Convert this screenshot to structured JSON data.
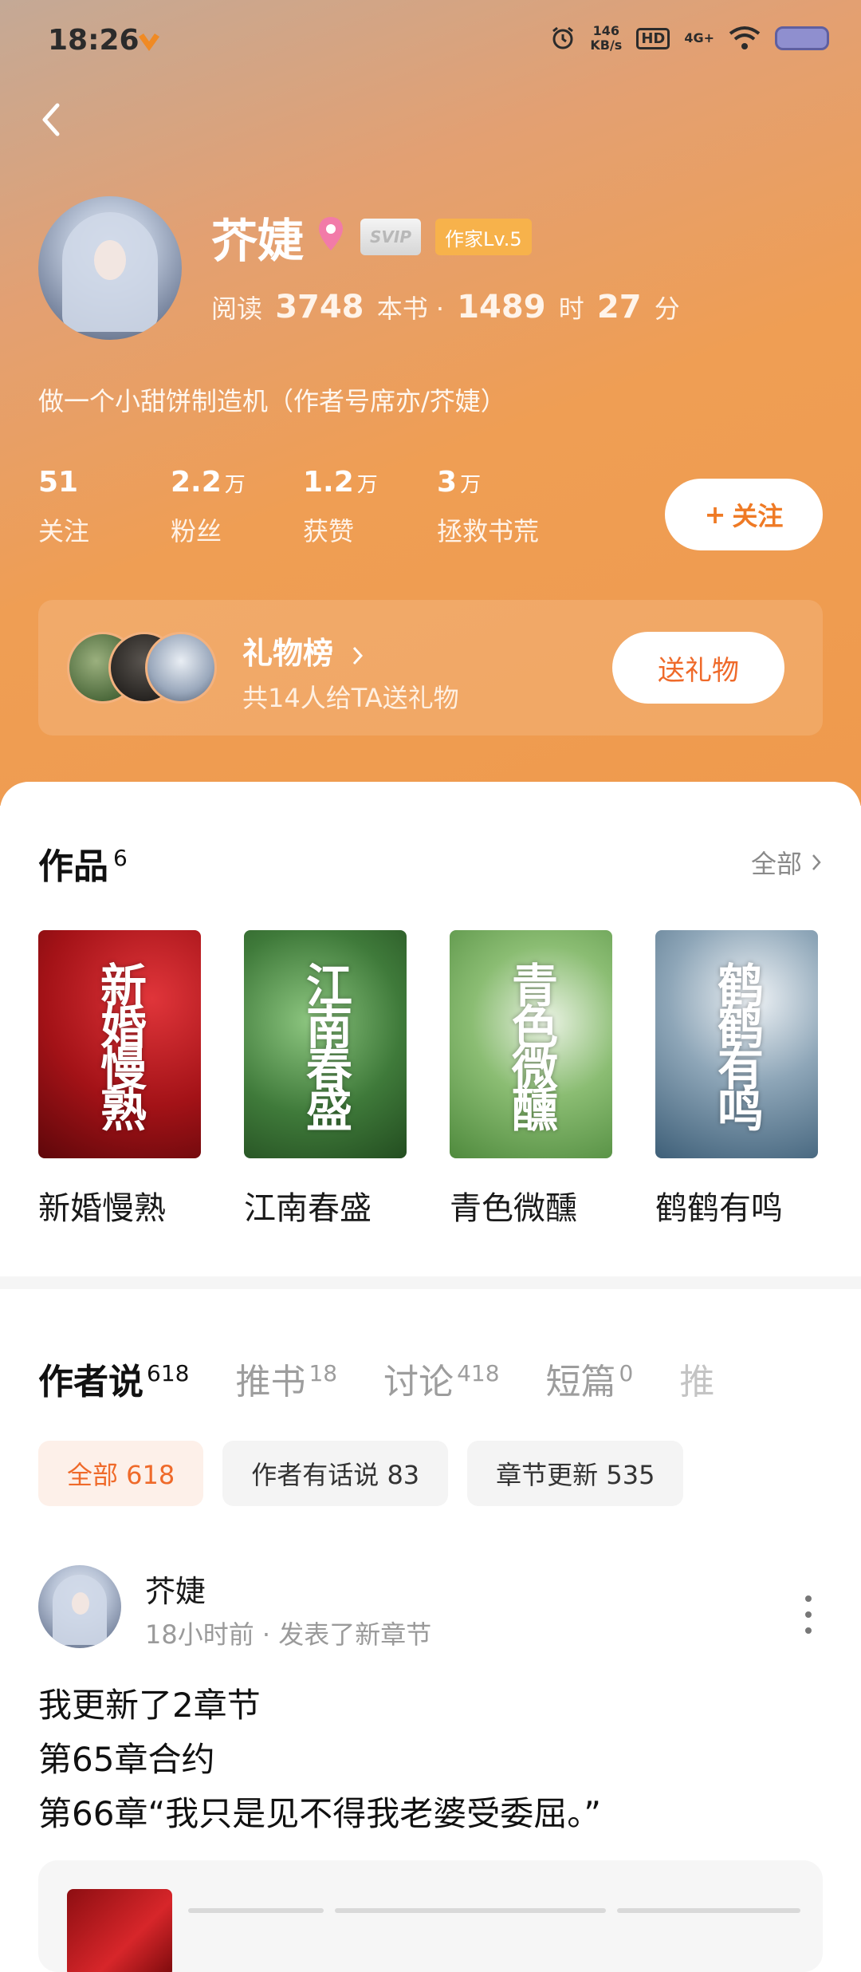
{
  "status_bar": {
    "time": "18:26",
    "net_speed_value": "146",
    "net_speed_unit": "KB/s",
    "hd": "HD",
    "signal": "4G+"
  },
  "profile": {
    "name": "芥婕",
    "svip_badge": "SVIP",
    "writer_badge": "作家Lv.5",
    "reading_label": "阅读",
    "books_read": "3748",
    "books_unit": "本书 ·",
    "hours": "1489",
    "hours_unit": "时",
    "minutes": "27",
    "minutes_unit": "分",
    "bio": "做一个小甜饼制造机（作者号席亦/芥婕）"
  },
  "stats": [
    {
      "value": "51",
      "unit": "",
      "label": "关注"
    },
    {
      "value": "2.2",
      "unit": "万",
      "label": "粉丝"
    },
    {
      "value": "1.2",
      "unit": "万",
      "label": "获赞"
    },
    {
      "value": "3",
      "unit": "万",
      "label": "拯救书荒"
    }
  ],
  "follow_button": {
    "plus": "+",
    "label": "关注"
  },
  "gift": {
    "title": "礼物榜",
    "subtitle": "共14人给TA送礼物",
    "button": "送礼物"
  },
  "works": {
    "title": "作品",
    "count": "6",
    "all_link": "全部",
    "books": [
      {
        "title": "新婚慢熟",
        "cover_text": "新婚慢熟",
        "cover_color": "#b3151b"
      },
      {
        "title": "江南春盛",
        "cover_text": "江南春盛",
        "cover_color": "#3f7a3a"
      },
      {
        "title": "青色微醺",
        "cover_text": "青色微醺",
        "cover_color": "#5d9a4c"
      },
      {
        "title": "鹤鹤有鸣",
        "cover_text": "鹤鹤有鸣",
        "cover_color": "#3e5f78"
      }
    ]
  },
  "tabs": [
    {
      "label": "作者说",
      "count": "618"
    },
    {
      "label": "推书",
      "count": "18"
    },
    {
      "label": "讨论",
      "count": "418"
    },
    {
      "label": "短篇",
      "count": "0"
    },
    {
      "label": "推",
      "count": ""
    }
  ],
  "filters": [
    {
      "label": "全部 618"
    },
    {
      "label": "作者有话说 83"
    },
    {
      "label": "章节更新 535"
    }
  ],
  "post": {
    "author": "芥婕",
    "meta": "18小时前 · 发表了新章节",
    "lines": [
      "我更新了2章节",
      "第65章合约",
      "第66章“我只是见不得我老婆受委屈。”"
    ]
  },
  "colors": {
    "accent": "#ef6a2a",
    "hero_orange": "#ef9e54",
    "writer_badge": "#f7b24b"
  }
}
